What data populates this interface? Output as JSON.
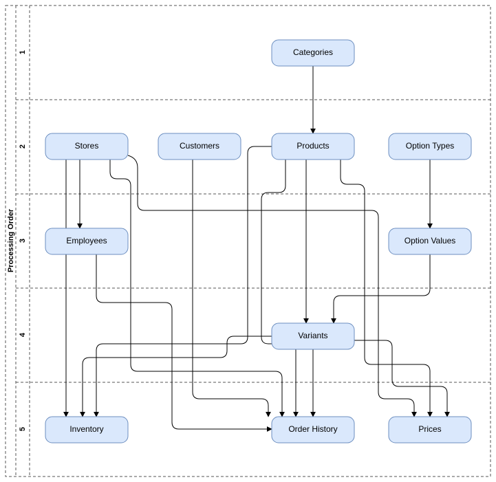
{
  "axis_label": "Processing Order",
  "lanes": {
    "1": "1",
    "2": "2",
    "3": "3",
    "4": "4",
    "5": "5"
  },
  "nodes": {
    "categories": "Categories",
    "stores": "Stores",
    "customers": "Customers",
    "products": "Products",
    "optiontypes": "Option Types",
    "employees": "Employees",
    "optionvalues": "Option Values",
    "variants": "Variants",
    "inventory": "Inventory",
    "orderhistory": "Order History",
    "prices": "Prices"
  },
  "chart_data": {
    "type": "diagram",
    "title": "Processing Order",
    "lanes": [
      {
        "order": 1,
        "nodes": [
          "Categories"
        ]
      },
      {
        "order": 2,
        "nodes": [
          "Stores",
          "Customers",
          "Products",
          "Option Types"
        ]
      },
      {
        "order": 3,
        "nodes": [
          "Employees",
          "Option Values"
        ]
      },
      {
        "order": 4,
        "nodes": [
          "Variants"
        ]
      },
      {
        "order": 5,
        "nodes": [
          "Inventory",
          "Order History",
          "Prices"
        ]
      }
    ],
    "edges": [
      {
        "from": "Categories",
        "to": "Products"
      },
      {
        "from": "Stores",
        "to": "Employees"
      },
      {
        "from": "Stores",
        "to": "Inventory"
      },
      {
        "from": "Stores",
        "to": "Order History"
      },
      {
        "from": "Stores",
        "to": "Prices"
      },
      {
        "from": "Customers",
        "to": "Order History"
      },
      {
        "from": "Products",
        "to": "Variants"
      },
      {
        "from": "Products",
        "to": "Inventory"
      },
      {
        "from": "Products",
        "to": "Order History"
      },
      {
        "from": "Products",
        "to": "Prices"
      },
      {
        "from": "Option Types",
        "to": "Option Values"
      },
      {
        "from": "Employees",
        "to": "Order History"
      },
      {
        "from": "Option Values",
        "to": "Variants"
      },
      {
        "from": "Variants",
        "to": "Inventory"
      },
      {
        "from": "Variants",
        "to": "Order History"
      },
      {
        "from": "Variants",
        "to": "Prices"
      }
    ]
  }
}
